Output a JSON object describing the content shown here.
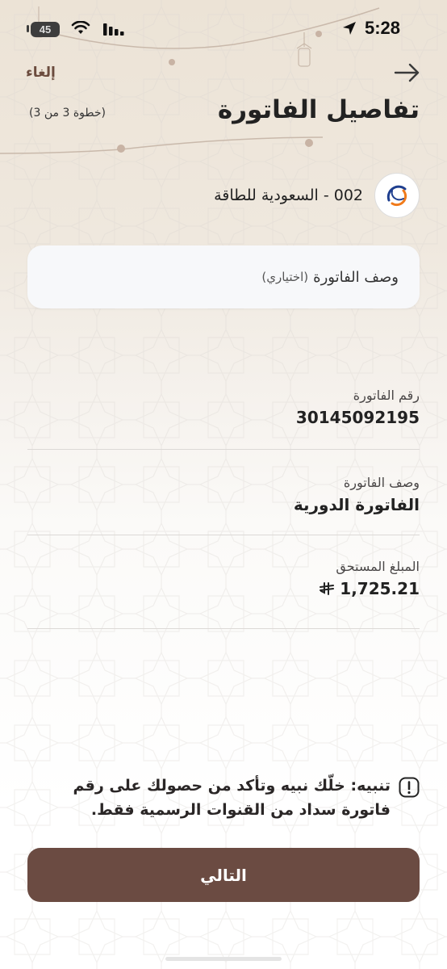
{
  "status_bar": {
    "time": "5:28",
    "battery_level": "45"
  },
  "header": {
    "cancel_label": "إلغاء",
    "title": "تفاصيل الفاتورة",
    "step": "(خطوة 3 من 3)"
  },
  "biller": {
    "name": "002 - السعودية للطاقة",
    "logo_icon": "saudi-electricity-logo"
  },
  "description_input": {
    "label": "وصف الفاتورة",
    "optional": "(اختياري)"
  },
  "details": [
    {
      "label": "رقم الفاتورة",
      "value": "30145092195"
    },
    {
      "label": "وصف الفاتورة",
      "value": "الفاتورة الدورية"
    },
    {
      "label": "المبلغ المستحق",
      "value": "1,725.21",
      "currency_symbol": "⃁"
    }
  ],
  "warning": {
    "icon": "exclamation-icon",
    "text": "تنبيه: خلّك نبيه وتأكد من حصولك على رقم فاتورة سداد من القنوات الرسمية فقط."
  },
  "next_button": {
    "label": "التالي"
  },
  "colors": {
    "primary": "#6b4b42",
    "accent_text": "#6b4b3e"
  }
}
